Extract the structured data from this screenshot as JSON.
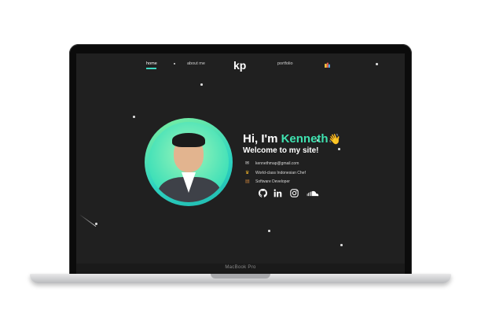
{
  "nav": {
    "home": "home",
    "about": "about me",
    "logo": "kp",
    "portfolio": "portfolio"
  },
  "hero": {
    "greeting_prefix": "Hi, I'm ",
    "name": "Kenneth",
    "wave": "👋",
    "welcome": "Welcome to my site!"
  },
  "info": {
    "email": "kennethmap@gmail.com",
    "chef": "World-class Indonesian Chef",
    "developer": "Software Developer"
  },
  "device": {
    "model": "MacBook Pro"
  },
  "colors": {
    "accent": "#3fe2b0",
    "background": "#202020"
  },
  "icons": [
    "github-icon",
    "linkedin-icon",
    "instagram-icon",
    "soundcloud-icon",
    "theme-toggle-icon"
  ]
}
